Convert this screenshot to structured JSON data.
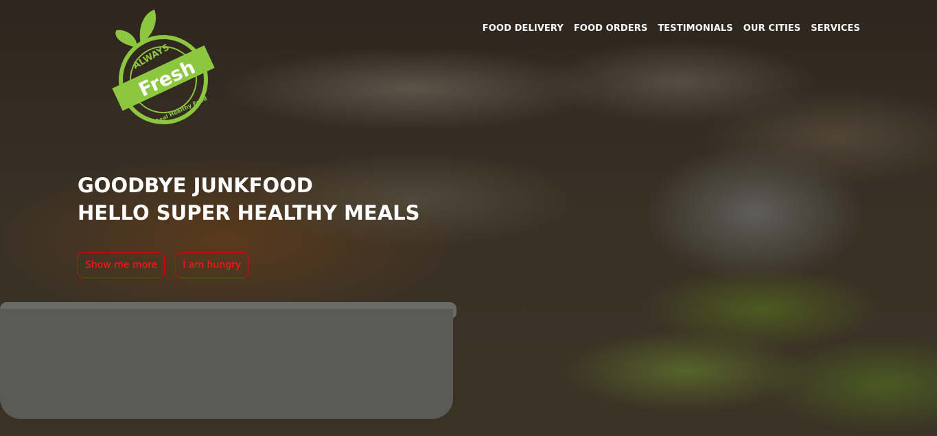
{
  "logo": {
    "top_text": "ALWAYS",
    "main_text": "Fresh",
    "bottom_text": "Real Healthy Food",
    "color": "#8dc63f"
  },
  "nav": {
    "items": [
      "FOOD DELIVERY",
      "FOOD ORDERS",
      "TESTIMONIALS",
      "OUR CITIES",
      "SERVICES"
    ]
  },
  "hero": {
    "line1": "GOODBYE JUNKFOOD",
    "line2": "HELLO SUPER HEALTHY MEALS",
    "buttons": [
      "Show me more",
      "I am hungry"
    ],
    "button_color": "#ff0000"
  }
}
